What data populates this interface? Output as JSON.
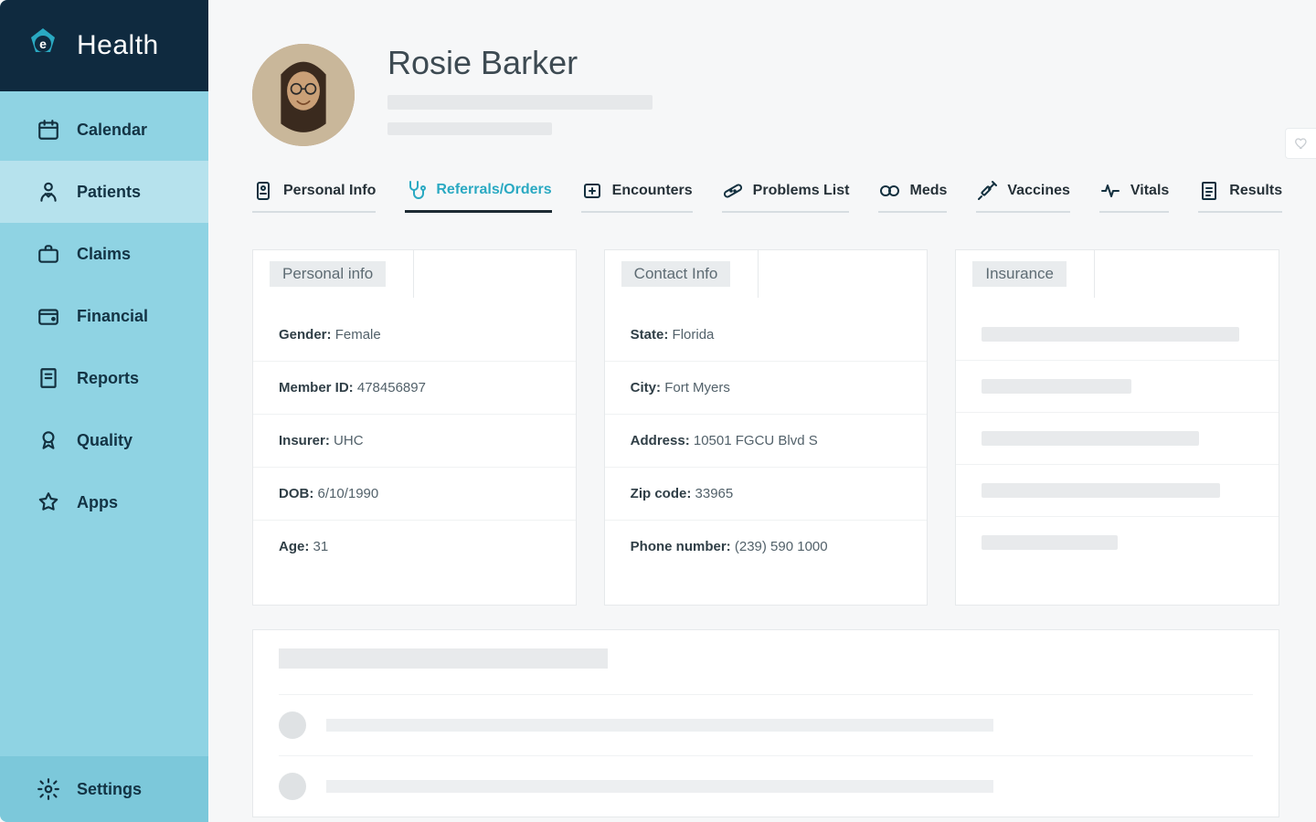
{
  "brand": {
    "name": "Health",
    "mark_letter": "e"
  },
  "sidebar": {
    "items": [
      {
        "label": "Calendar"
      },
      {
        "label": "Patients"
      },
      {
        "label": "Claims"
      },
      {
        "label": "Financial"
      },
      {
        "label": "Reports"
      },
      {
        "label": "Quality"
      },
      {
        "label": "Apps"
      }
    ],
    "footer": {
      "label": "Settings"
    },
    "active_index": 1
  },
  "patient": {
    "name": "Rosie Barker"
  },
  "tabs": [
    {
      "label": "Personal Info"
    },
    {
      "label": "Referrals/Orders"
    },
    {
      "label": "Encounters"
    },
    {
      "label": "Problems List"
    },
    {
      "label": "Meds"
    },
    {
      "label": "Vaccines"
    },
    {
      "label": "Vitals"
    },
    {
      "label": "Results"
    }
  ],
  "active_tab_index": 1,
  "cards": {
    "personal": {
      "title": "Personal info",
      "rows": [
        {
          "k": "Gender:",
          "v": "Female"
        },
        {
          "k": "Member ID:",
          "v": "478456897"
        },
        {
          "k": "Insurer:",
          "v": "UHC"
        },
        {
          "k": "DOB:",
          "v": "6/10/1990"
        },
        {
          "k": "Age:",
          "v": "31"
        }
      ]
    },
    "contact": {
      "title": "Contact Info",
      "rows": [
        {
          "k": "State:",
          "v": "Florida"
        },
        {
          "k": "City:",
          "v": "Fort Myers"
        },
        {
          "k": "Address:",
          "v": "10501 FGCU Blvd S"
        },
        {
          "k": "Zip code:",
          "v": "33965"
        },
        {
          "k": "Phone number:",
          "v": "(239) 590 1000"
        }
      ]
    },
    "insurance": {
      "title": "Insurance",
      "placeholder_rows": 5
    }
  }
}
